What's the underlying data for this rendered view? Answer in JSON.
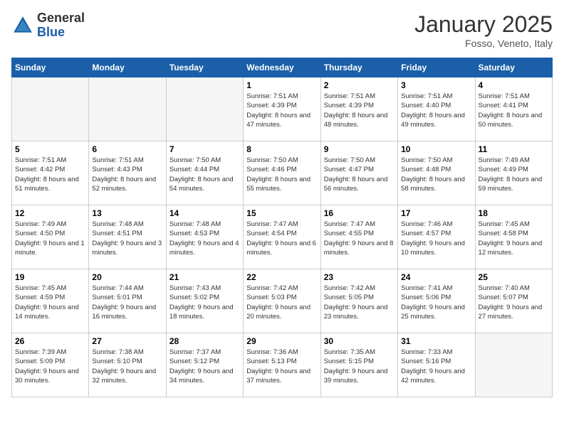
{
  "logo": {
    "general": "General",
    "blue": "Blue"
  },
  "title": "January 2025",
  "location": "Fosso, Veneto, Italy",
  "headers": [
    "Sunday",
    "Monday",
    "Tuesday",
    "Wednesday",
    "Thursday",
    "Friday",
    "Saturday"
  ],
  "weeks": [
    [
      {
        "day": "",
        "info": "",
        "empty": true
      },
      {
        "day": "",
        "info": "",
        "empty": true
      },
      {
        "day": "",
        "info": "",
        "empty": true
      },
      {
        "day": "1",
        "info": "Sunrise: 7:51 AM\nSunset: 4:39 PM\nDaylight: 8 hours and 47 minutes."
      },
      {
        "day": "2",
        "info": "Sunrise: 7:51 AM\nSunset: 4:39 PM\nDaylight: 8 hours and 48 minutes."
      },
      {
        "day": "3",
        "info": "Sunrise: 7:51 AM\nSunset: 4:40 PM\nDaylight: 8 hours and 49 minutes."
      },
      {
        "day": "4",
        "info": "Sunrise: 7:51 AM\nSunset: 4:41 PM\nDaylight: 8 hours and 50 minutes."
      }
    ],
    [
      {
        "day": "5",
        "info": "Sunrise: 7:51 AM\nSunset: 4:42 PM\nDaylight: 8 hours and 51 minutes."
      },
      {
        "day": "6",
        "info": "Sunrise: 7:51 AM\nSunset: 4:43 PM\nDaylight: 8 hours and 52 minutes."
      },
      {
        "day": "7",
        "info": "Sunrise: 7:50 AM\nSunset: 4:44 PM\nDaylight: 8 hours and 54 minutes."
      },
      {
        "day": "8",
        "info": "Sunrise: 7:50 AM\nSunset: 4:46 PM\nDaylight: 8 hours and 55 minutes."
      },
      {
        "day": "9",
        "info": "Sunrise: 7:50 AM\nSunset: 4:47 PM\nDaylight: 8 hours and 56 minutes."
      },
      {
        "day": "10",
        "info": "Sunrise: 7:50 AM\nSunset: 4:48 PM\nDaylight: 8 hours and 58 minutes."
      },
      {
        "day": "11",
        "info": "Sunrise: 7:49 AM\nSunset: 4:49 PM\nDaylight: 8 hours and 59 minutes."
      }
    ],
    [
      {
        "day": "12",
        "info": "Sunrise: 7:49 AM\nSunset: 4:50 PM\nDaylight: 9 hours and 1 minute."
      },
      {
        "day": "13",
        "info": "Sunrise: 7:48 AM\nSunset: 4:51 PM\nDaylight: 9 hours and 3 minutes."
      },
      {
        "day": "14",
        "info": "Sunrise: 7:48 AM\nSunset: 4:53 PM\nDaylight: 9 hours and 4 minutes."
      },
      {
        "day": "15",
        "info": "Sunrise: 7:47 AM\nSunset: 4:54 PM\nDaylight: 9 hours and 6 minutes."
      },
      {
        "day": "16",
        "info": "Sunrise: 7:47 AM\nSunset: 4:55 PM\nDaylight: 9 hours and 8 minutes."
      },
      {
        "day": "17",
        "info": "Sunrise: 7:46 AM\nSunset: 4:57 PM\nDaylight: 9 hours and 10 minutes."
      },
      {
        "day": "18",
        "info": "Sunrise: 7:45 AM\nSunset: 4:58 PM\nDaylight: 9 hours and 12 minutes."
      }
    ],
    [
      {
        "day": "19",
        "info": "Sunrise: 7:45 AM\nSunset: 4:59 PM\nDaylight: 9 hours and 14 minutes."
      },
      {
        "day": "20",
        "info": "Sunrise: 7:44 AM\nSunset: 5:01 PM\nDaylight: 9 hours and 16 minutes."
      },
      {
        "day": "21",
        "info": "Sunrise: 7:43 AM\nSunset: 5:02 PM\nDaylight: 9 hours and 18 minutes."
      },
      {
        "day": "22",
        "info": "Sunrise: 7:42 AM\nSunset: 5:03 PM\nDaylight: 9 hours and 20 minutes."
      },
      {
        "day": "23",
        "info": "Sunrise: 7:42 AM\nSunset: 5:05 PM\nDaylight: 9 hours and 23 minutes."
      },
      {
        "day": "24",
        "info": "Sunrise: 7:41 AM\nSunset: 5:06 PM\nDaylight: 9 hours and 25 minutes."
      },
      {
        "day": "25",
        "info": "Sunrise: 7:40 AM\nSunset: 5:07 PM\nDaylight: 9 hours and 27 minutes."
      }
    ],
    [
      {
        "day": "26",
        "info": "Sunrise: 7:39 AM\nSunset: 5:09 PM\nDaylight: 9 hours and 30 minutes."
      },
      {
        "day": "27",
        "info": "Sunrise: 7:38 AM\nSunset: 5:10 PM\nDaylight: 9 hours and 32 minutes."
      },
      {
        "day": "28",
        "info": "Sunrise: 7:37 AM\nSunset: 5:12 PM\nDaylight: 9 hours and 34 minutes."
      },
      {
        "day": "29",
        "info": "Sunrise: 7:36 AM\nSunset: 5:13 PM\nDaylight: 9 hours and 37 minutes."
      },
      {
        "day": "30",
        "info": "Sunrise: 7:35 AM\nSunset: 5:15 PM\nDaylight: 9 hours and 39 minutes."
      },
      {
        "day": "31",
        "info": "Sunrise: 7:33 AM\nSunset: 5:16 PM\nDaylight: 9 hours and 42 minutes."
      },
      {
        "day": "",
        "info": "",
        "empty": true
      }
    ]
  ]
}
